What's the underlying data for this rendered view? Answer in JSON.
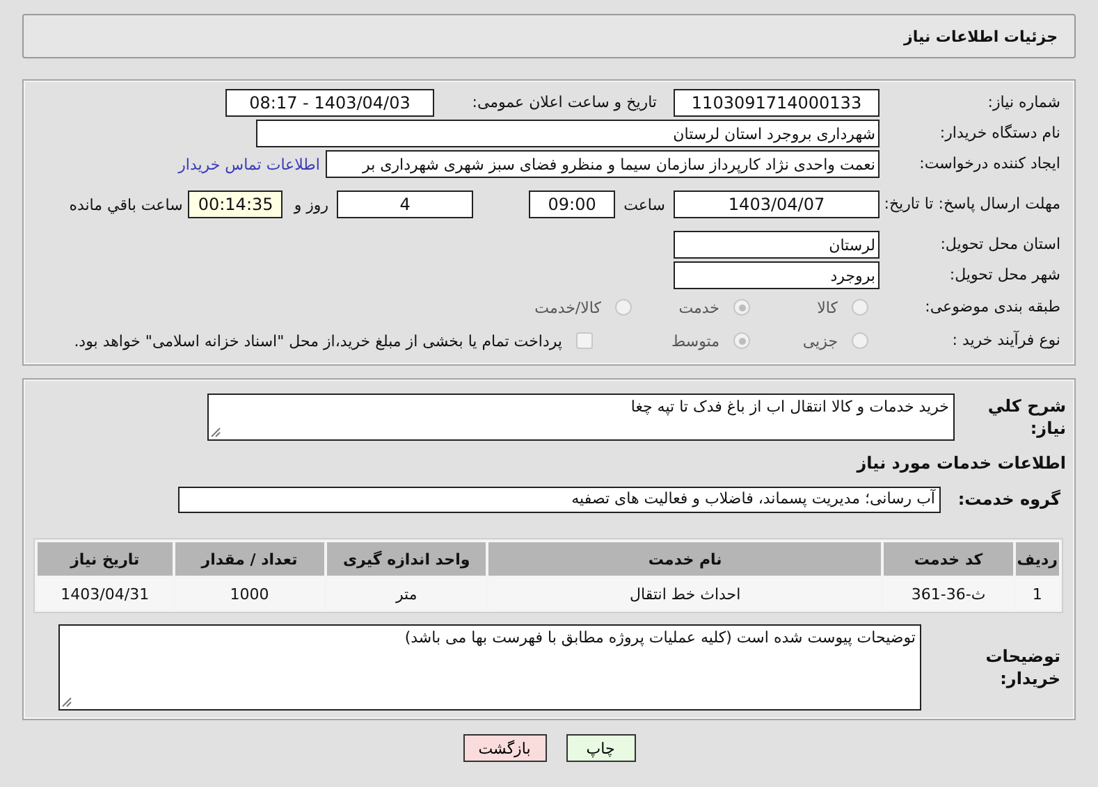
{
  "header": {
    "title": "جزئیات اطلاعات نیاز"
  },
  "need_number": {
    "label": "شماره نیاز:",
    "value": "1103091714000133"
  },
  "announce": {
    "label": "تاریخ و ساعت اعلان عمومی:",
    "value": "1403/04/03 - 08:17"
  },
  "buyer": {
    "label": "نام دستگاه خریدار:",
    "value": "شهرداری بروجرد استان لرستان"
  },
  "creator": {
    "label": "ایجاد کننده درخواست:",
    "value": "نعمت واحدی نژاد کارپرداز سازمان سیما و منظرو فضای سبز شهری شهرداری بر",
    "link": "اطلاعات تماس خریدار"
  },
  "deadline": {
    "label": "مهلت ارسال پاسخ: تا تاریخ:",
    "date": "1403/04/07",
    "time_label": "ساعت",
    "time": "09:00",
    "days": "4",
    "days_label": "روز و",
    "remaining": "00:14:35",
    "remaining_label": "ساعت باقي مانده"
  },
  "province": {
    "label": "استان محل تحویل:",
    "value": "لرستان"
  },
  "city": {
    "label": "شهر محل تحویل:",
    "value": "بروجرد"
  },
  "category": {
    "label": "طبقه بندی موضوعی:",
    "options": [
      {
        "label": "کالا",
        "selected": false
      },
      {
        "label": "خدمت",
        "selected": true
      },
      {
        "label": "کالا/خدمت",
        "selected": false
      }
    ]
  },
  "purchase_type": {
    "label": "نوع فرآیند خرید :",
    "options": [
      {
        "label": "جزیی",
        "selected": false
      },
      {
        "label": "متوسط",
        "selected": true
      }
    ],
    "payment": {
      "label": "پرداخت تمام یا بخشی از مبلغ خرید،از محل \"اسناد خزانه اسلامی\" خواهد بود.",
      "checked": false
    }
  },
  "description": {
    "label": "شرح کلي نیاز:",
    "value": "خرید خدمات و کالا انتقال اب از باغ فدک تا تپه چغا"
  },
  "services_title": "اطلاعات خدمات مورد نیاز",
  "service_group": {
    "label": "گروه خدمت:",
    "value": "آب رسانی؛ مدیریت پسماند، فاضلاب و فعالیت های تصفیه"
  },
  "table": {
    "columns": [
      "ردیف",
      "کد خدمت",
      "نام خدمت",
      "واحد اندازه گیری",
      "تعداد / مقدار",
      "تاریخ نیاز"
    ],
    "rows": [
      [
        "1",
        "ث-36-361",
        "احداث خط انتقال",
        "متر",
        "1000",
        "1403/04/31"
      ]
    ]
  },
  "buyer_notes": {
    "label": "توضیحات خریدار:",
    "value": "توضیحات پیوست شده است (کلیه عملیات پروژه مطابق با فهرست بها می باشد)"
  },
  "buttons": [
    {
      "label": "چاپ",
      "kind": "print"
    },
    {
      "label": "بازگشت",
      "kind": "back"
    }
  ]
}
